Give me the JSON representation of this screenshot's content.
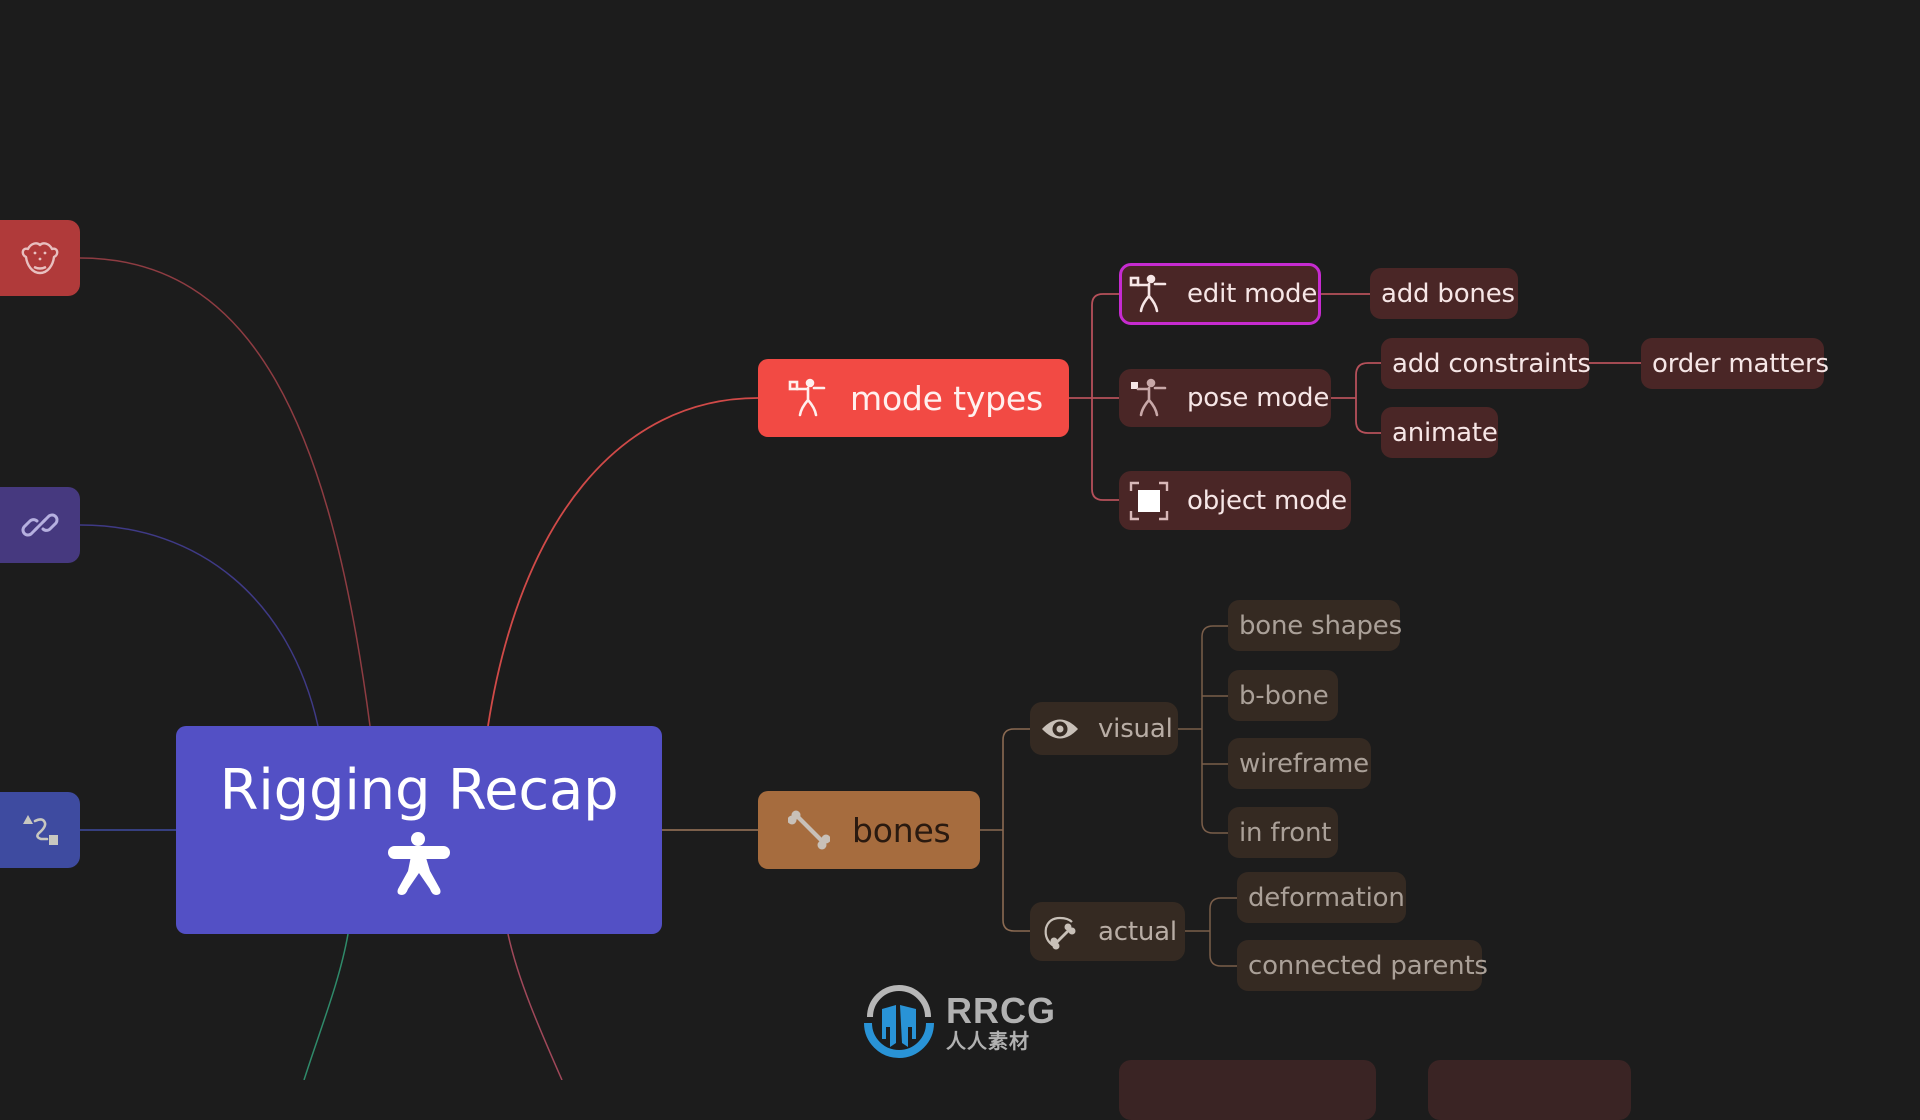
{
  "theme": {
    "background": "#1c1c1c",
    "root_color": "#5350c5",
    "mode_types_color": "#f24a44",
    "bones_color": "#a66c3e",
    "selected_outline": "#c62bd0",
    "red_branch_line": "#b5505a",
    "brown_branch_line": "#8a6a52"
  },
  "mindmap": {
    "root": {
      "label": "Rigging Recap",
      "icon": "rig-figure-icon"
    },
    "side_nodes": [
      {
        "icon": "monkey-head-icon",
        "color": "#b03a3a"
      },
      {
        "icon": "link-icon",
        "color": "#46397f"
      },
      {
        "icon": "constraint-icon",
        "color": "#3e4ba0"
      }
    ],
    "mode_types": {
      "label": "mode types",
      "icon": "armature-figure-icon",
      "children": [
        {
          "label": "edit mode",
          "icon": "armature-edit-icon",
          "selected": true,
          "children": [
            {
              "label": "add bones"
            }
          ]
        },
        {
          "label": "pose mode",
          "icon": "armature-pose-icon",
          "selected": false,
          "children": [
            {
              "label": "add constraints",
              "children": [
                {
                  "label": "order matters"
                }
              ]
            },
            {
              "label": "animate"
            }
          ]
        },
        {
          "label": "object mode",
          "icon": "object-select-icon",
          "selected": false,
          "children": []
        }
      ]
    },
    "bones": {
      "label": "bones",
      "icon": "bone-icon",
      "children": [
        {
          "label": "visual",
          "icon": "eye-icon",
          "children": [
            {
              "label": "bone shapes"
            },
            {
              "label": "b-bone"
            },
            {
              "label": "wireframe"
            },
            {
              "label": "in front"
            }
          ]
        },
        {
          "label": "actual",
          "icon": "bone-deform-icon",
          "children": [
            {
              "label": "deformation"
            },
            {
              "label": "connected parents"
            }
          ]
        }
      ]
    }
  },
  "watermark": {
    "title": "RRCG",
    "subtitle": "人人素材"
  }
}
